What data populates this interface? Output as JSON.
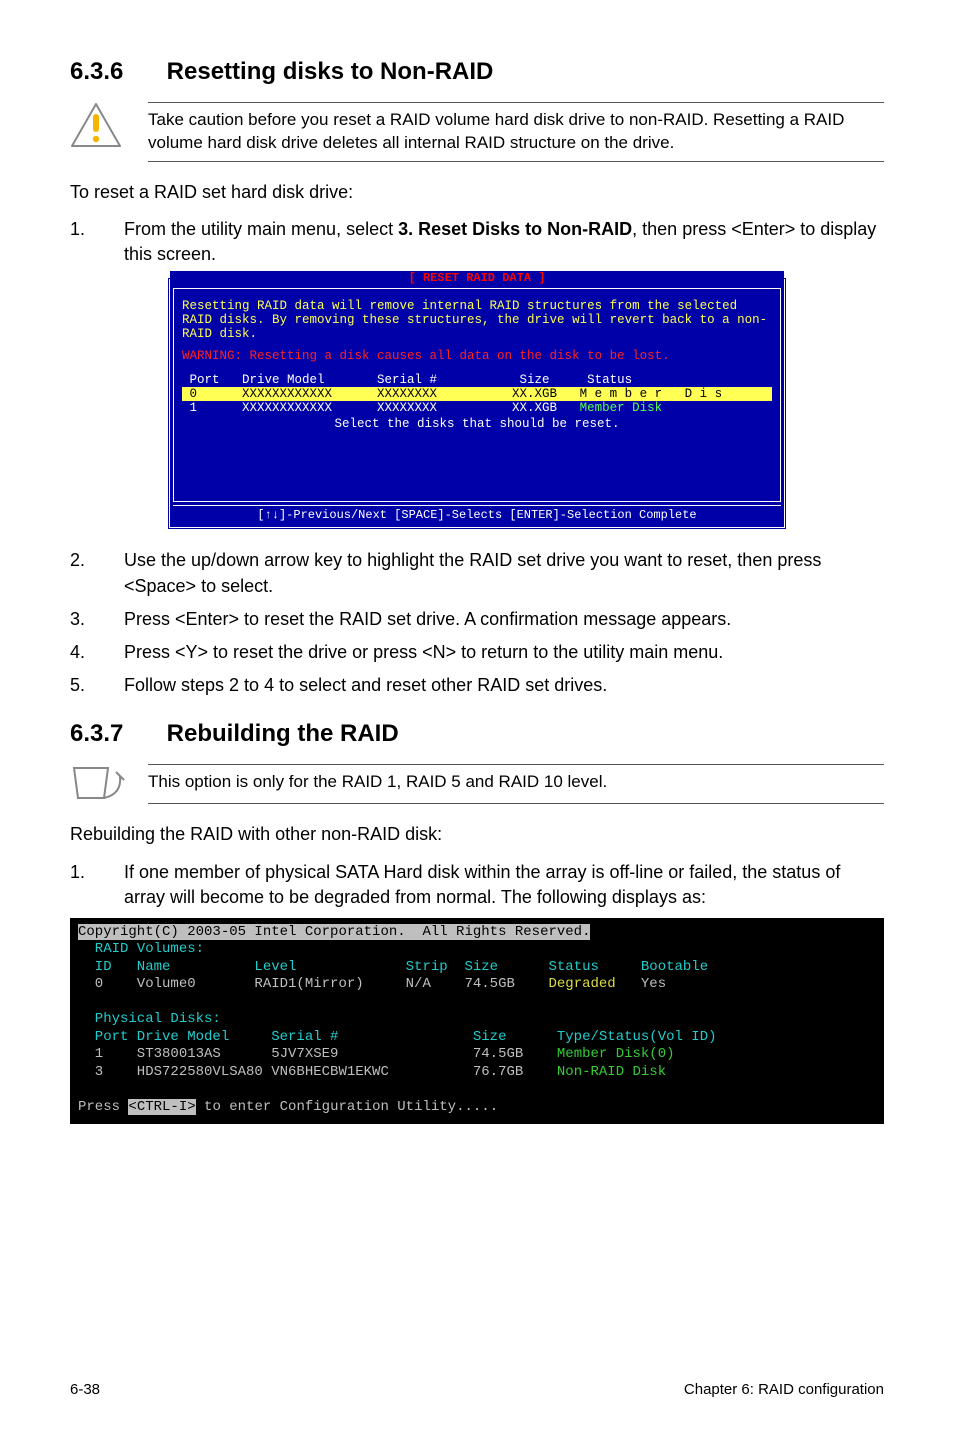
{
  "section1": {
    "num": "6.3.6",
    "title": "Resetting disks to Non-RAID",
    "caution": "Take caution before you reset a RAID volume hard disk drive to non-RAID. Resetting a RAID volume hard disk drive deletes all internal RAID structure on the drive.",
    "intro": "To reset a RAID set hard disk drive:",
    "step1_n": "1.",
    "step1_t_a": "From the utility main menu, select ",
    "step1_t_b": "3. Reset Disks to Non-RAID",
    "step1_t_c": ", then press <Enter> to display this screen.",
    "step2_n": "2.",
    "step2_t": "Use the up/down arrow key to highlight the RAID set drive you want to reset, then press <Space> to select.",
    "step3_n": "3.",
    "step3_t": "Press <Enter> to reset the RAID set drive. A confirmation message appears.",
    "step4_n": "4.",
    "step4_t": "Press <Y> to reset the drive or press <N> to return to the utility main menu.",
    "step5_n": "5.",
    "step5_t": "Follow steps 2 to 4 to select and reset other RAID set drives."
  },
  "bios": {
    "title": "[ RESET RAID DATA ]",
    "body1": "Resetting RAID data will remove internal RAID structures from the selected RAID disks. By removing these structures, the drive will revert back to a non-RAID disk.",
    "warn": "WARNING: Resetting a disk causes all data on the disk to be lost.",
    "head": " Port   Drive Model       Serial #           Size     Status",
    "row0": " 0      XXXXXXXXXXXX      XXXXXXXX          XX.XGB   M e m b e r   D i s",
    "row1_a": " 1      XXXXXXXXXXXX      XXXXXXXX          XX.XGB   ",
    "row1_b": "Member Disk",
    "center": "Select the disks that should be reset.",
    "foot": "[↑↓]-Previous/Next   [SPACE]-Selects   [ENTER]-Selection Complete"
  },
  "section2": {
    "num": "6.3.7",
    "title": "Rebuilding the RAID",
    "note": "This option is only for the RAID 1, RAID 5 and RAID 10 level.",
    "intro": "Rebuilding the RAID with other non-RAID disk:",
    "step1_n": "1.",
    "step1_t": "If one member of physical SATA Hard disk within the array is off-line or failed, the status of array will become to be degraded from normal. The following displays as:"
  },
  "term": {
    "line0_a": "Copyright(C) 2003-05 Intel Corporation.  All Rights Reserved.",
    "line1": "  RAID Volumes:",
    "line2": "  ID   Name          Level             Strip  Size      Status     Bootable",
    "line3_a": "  0    Volume0       RAID1(Mirror)     N/A    74.5GB    ",
    "line3_b": "Degraded",
    "line3_c": "   Yes",
    "line4": "  Physical Disks:",
    "line5": "  Port Drive Model     Serial #                Size      Type/Status(Vol ID)",
    "line6_a": "  1    ST380013AS      5JV7XSE9                74.5GB    ",
    "line6_b": "Member Disk(0)",
    "line7_a": "  3    HDS722580VLSA80 VN6BHECBW1EKWC          76.7GB    ",
    "line7_b": "Non-RAID Disk",
    "line8_a": "Press ",
    "line8_b": "<CTRL-I>",
    "line8_c": " to enter Configuration Utility....."
  },
  "footer": {
    "left": "6-38",
    "right": "Chapter 6: RAID configuration"
  },
  "chart_data": {
    "type": "table",
    "tables": [
      {
        "title": "RESET RAID DATA — disk list",
        "columns": [
          "Port",
          "Drive Model",
          "Serial #",
          "Size",
          "Status"
        ],
        "rows": [
          [
            "0",
            "XXXXXXXXXXXX",
            "XXXXXXXX",
            "XX.XGB",
            "Member Dis"
          ],
          [
            "1",
            "XXXXXXXXXXXX",
            "XXXXXXXX",
            "XX.XGB",
            "Member Disk"
          ]
        ]
      },
      {
        "title": "RAID Volumes",
        "columns": [
          "ID",
          "Name",
          "Level",
          "Strip",
          "Size",
          "Status",
          "Bootable"
        ],
        "rows": [
          [
            "0",
            "Volume0",
            "RAID1(Mirror)",
            "N/A",
            "74.5GB",
            "Degraded",
            "Yes"
          ]
        ]
      },
      {
        "title": "Physical Disks",
        "columns": [
          "Port",
          "Drive Model",
          "Serial #",
          "Size",
          "Type/Status(Vol ID)"
        ],
        "rows": [
          [
            "1",
            "ST380013AS",
            "5JV7XSE9",
            "74.5GB",
            "Member Disk(0)"
          ],
          [
            "3",
            "HDS722580VLSA80",
            "VN6BHECBW1EKWC",
            "76.7GB",
            "Non-RAID Disk"
          ]
        ]
      }
    ]
  }
}
